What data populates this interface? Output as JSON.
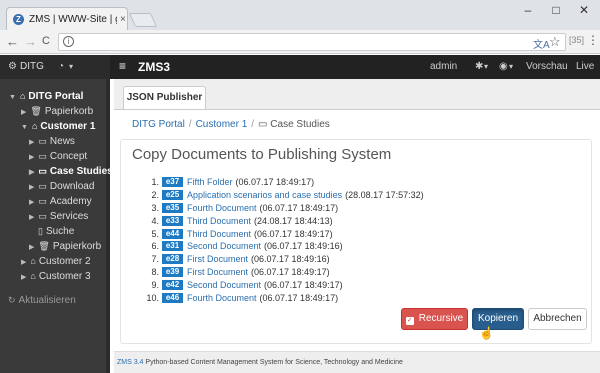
{
  "browser": {
    "tab_title": "ZMS | WWW-Site | ger",
    "tab_close": "×",
    "favicon": "Z",
    "win_minimize": "–",
    "win_maximize": "□",
    "win_close": "✕",
    "back": "←",
    "forward": "→",
    "reload": "C",
    "info": "i",
    "url": "",
    "ext": "[35]",
    "menu": "⋮"
  },
  "navbar": {
    "site": "DITG",
    "brand": "ZMS3",
    "user": "admin",
    "gear_caret": "▾",
    "globe_caret": "▾",
    "preview": "Vorschau",
    "live": "Live"
  },
  "sidebar": {
    "items": [
      {
        "label": "DITG Portal",
        "icon": "home-icon"
      },
      {
        "label": "Papierkorb",
        "icon": "trash-icon"
      },
      {
        "label": "Customer 1",
        "icon": "home-icon"
      },
      {
        "label": "News",
        "icon": "folder-icon"
      },
      {
        "label": "Concept",
        "icon": "folder-icon"
      },
      {
        "label": "Case Studies",
        "icon": "folder-icon"
      },
      {
        "label": "Download",
        "icon": "folder-icon"
      },
      {
        "label": "Academy",
        "icon": "folder-icon"
      },
      {
        "label": "Services",
        "icon": "folder-icon"
      },
      {
        "label": "Suche",
        "icon": "document-icon"
      },
      {
        "label": "Papierkorb",
        "icon": "trash-icon"
      },
      {
        "label": "Customer 2",
        "icon": "home-icon"
      },
      {
        "label": "Customer 3",
        "icon": "home-icon"
      }
    ],
    "refresh_label": "Aktualisieren"
  },
  "content": {
    "tab_label": "JSON Publisher",
    "breadcrumb": [
      "DITG Portal",
      "Customer 1",
      "Case Studies"
    ],
    "heading": "Copy Documents to Publishing System",
    "documents": [
      {
        "num": "1.",
        "id": "e37",
        "title": "Fifth Folder",
        "date": "(06.07.17 18:49:17)"
      },
      {
        "num": "2.",
        "id": "e25",
        "title": "Application scenarios and case studies",
        "date": "(28.08.17 17:57:32)"
      },
      {
        "num": "3.",
        "id": "e35",
        "title": "Fourth Document",
        "date": "(06.07.17 18:49:17)"
      },
      {
        "num": "4.",
        "id": "e33",
        "title": "Third Document",
        "date": "(24.08.17 18:44:13)"
      },
      {
        "num": "5.",
        "id": "e44",
        "title": "Third Document",
        "date": "(06.07.17 18:49:17)"
      },
      {
        "num": "6.",
        "id": "e31",
        "title": "Second Document",
        "date": "(06.07.17 18:49:16)"
      },
      {
        "num": "7.",
        "id": "e28",
        "title": "First Document",
        "date": "(06.07.17 18:49:16)"
      },
      {
        "num": "8.",
        "id": "e39",
        "title": "First Document",
        "date": "(06.07.17 18:49:17)"
      },
      {
        "num": "9.",
        "id": "e42",
        "title": "Second Document",
        "date": "(06.07.17 18:49:17)"
      },
      {
        "num": "10.",
        "id": "e46",
        "title": "Fourth Document",
        "date": "(06.07.17 18:49:17)"
      }
    ],
    "recursive_label": "Recursive",
    "recursive_checked": true,
    "copy_label": "Kopieren",
    "cancel_label": "Abbrechen"
  },
  "footer": {
    "version": "ZMS 3.4",
    "text": "Python-based Content Management System for Science, Technology and Medicine"
  },
  "colors": {
    "accent": "#1f7ac4",
    "danger": "#d9534f",
    "primary": "#285e8e",
    "navbar": "#222222",
    "sidebar": "#3a3a3a"
  }
}
